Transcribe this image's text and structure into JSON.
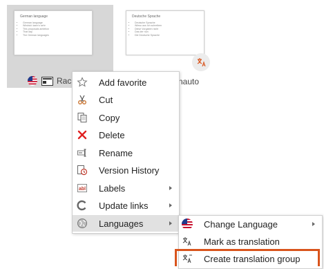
{
  "thumbnails": [
    {
      "slide_title": "German language",
      "bullets": [
        "German language",
        "Windski: kann's sehr",
        "This proposals ambition",
        "That day",
        "The German languages"
      ],
      "name": "Raci",
      "language_flag": "us-flag-icon"
    },
    {
      "slide_title": "Deutsche Sprache",
      "bullets": [
        "Deutsche Sprache",
        "Wieso aus Ich schreiben",
        "Diese Vorgaben nicht",
        "Das der nun",
        "Die Deutsche Sprache"
      ],
      "name": "nauto",
      "badge_icon": "translation-icon"
    }
  ],
  "context_menu": {
    "items": [
      {
        "label": "Add favorite",
        "icon": "star-icon"
      },
      {
        "label": "Cut",
        "icon": "scissors-icon"
      },
      {
        "label": "Copy",
        "icon": "copy-icon"
      },
      {
        "label": "Delete",
        "icon": "delete-x-icon"
      },
      {
        "label": "Rename",
        "icon": "rename-icon"
      },
      {
        "label": "Version History",
        "icon": "version-history-icon"
      },
      {
        "label": "Labels",
        "icon": "labels-icon",
        "submenu": true
      },
      {
        "label": "Update links",
        "icon": "update-links-icon",
        "submenu": true
      },
      {
        "label": "Languages",
        "icon": "globe-icon",
        "submenu": true,
        "highlighted": true
      }
    ]
  },
  "languages_submenu": {
    "items": [
      {
        "label": "Change Language",
        "icon": "us-flag-icon",
        "submenu": true
      },
      {
        "label": "Mark as translation",
        "icon": "mark-translation-icon"
      },
      {
        "label": "Create translation group",
        "icon": "translation-group-icon",
        "emphasized": true
      }
    ]
  },
  "colors": {
    "highlight_border": "#d9541c",
    "menu_hover": "#e1e1e1",
    "delete_red": "#e02020"
  }
}
